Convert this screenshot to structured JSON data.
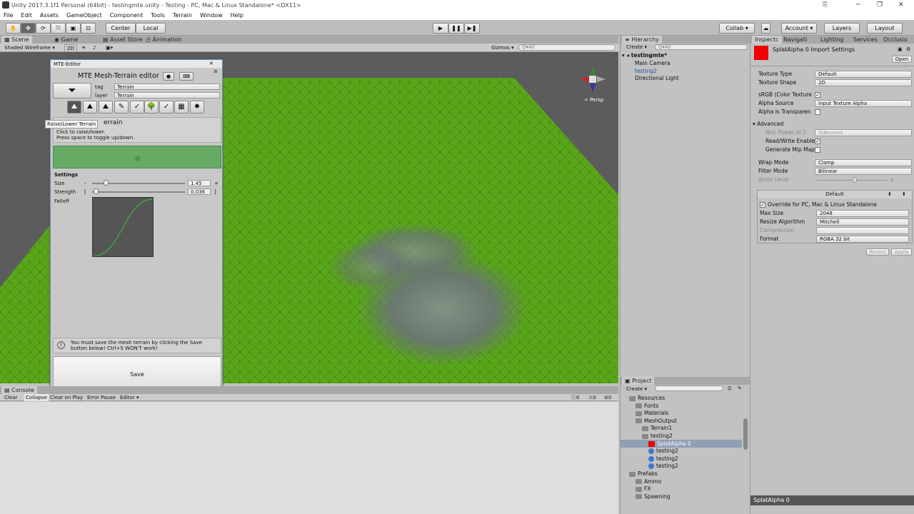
{
  "window": {
    "title": "Unity 2017.3.1f1 Personal (64bit) - testingmte.unity - Testing - PC, Mac & Linux Standalone* <DX11>"
  },
  "menu": [
    "File",
    "Edit",
    "Assets",
    "GameObject",
    "Component",
    "Tools",
    "Terrain",
    "Window",
    "Help"
  ],
  "toolbar": {
    "center": "Center",
    "local": "Local",
    "collab": "Collab ▾",
    "account": "Account ▾",
    "layers": "Layers",
    "layout": "Layout"
  },
  "tabs": {
    "scene": "Scene",
    "game": "Game",
    "asset_store": "Asset Store",
    "animation": "Animation",
    "hierarchy": "Hierarchy",
    "inspector": "Inspectc",
    "navigation": "Navigati",
    "lighting": "Lighting",
    "services": "Services",
    "occlusion": "Occlusio",
    "project": "Project",
    "console": "Console"
  },
  "scenebar": {
    "shading": "Shaded Wireframe",
    "mode2d": "2D",
    "gizmos": "Gizmos",
    "search": "Q▾All",
    "persp": "< Persp"
  },
  "mte": {
    "window_title": "MTE-Editor",
    "title": "MTE Mesh-Terrain editor",
    "tag_label": "tag",
    "tag_value": "Terrain",
    "layer_label": "layer",
    "layer_value": "Terrain",
    "tool_name": "errain",
    "tooltip": "Raise/Lower Terrain",
    "desc1": "Click to raise/lower.",
    "desc2": "Press space to toggle up/down.",
    "settings": "Settings",
    "size_label": "Size",
    "size_value": "1.45",
    "strength_label": "Strength",
    "strength_value": "0.036",
    "falloff_label": "Falloff",
    "warning": "You must save the mesh terrain by clicking the Save button below! Ctrl+S WON'T work!",
    "save": "Save"
  },
  "hierarchy": {
    "create": "Create ▾",
    "search": "Q▾All",
    "scene": "testingmte*",
    "items": [
      "Main Camera",
      "testing2",
      "Directional Light"
    ]
  },
  "project": {
    "create": "Create ▾",
    "items": [
      {
        "label": "Resources",
        "indent": 0
      },
      {
        "label": "Fonts",
        "indent": 1
      },
      {
        "label": "Materials",
        "indent": 1
      },
      {
        "label": "MeshOutput",
        "indent": 1
      },
      {
        "label": "Terrain1",
        "indent": 2
      },
      {
        "label": "testing2",
        "indent": 2
      },
      {
        "label": "SplatAlpha 0",
        "indent": 3,
        "selected": true
      },
      {
        "label": "testing2",
        "indent": 3
      },
      {
        "label": "testing2",
        "indent": 3
      },
      {
        "label": "testing2",
        "indent": 3
      },
      {
        "label": "Prefabs",
        "indent": 0
      },
      {
        "label": "Ammo",
        "indent": 1
      },
      {
        "label": "FX",
        "indent": 1
      },
      {
        "label": "Spawning",
        "indent": 1
      }
    ]
  },
  "inspector": {
    "title": "SplatAlpha 0 Import Settings",
    "open": "Open",
    "rows": [
      {
        "label": "Texture Type",
        "value": "Default"
      },
      {
        "label": "Texture Shape",
        "value": "2D"
      }
    ],
    "srgb": "sRGB (Color Texture",
    "alpha_source": "Alpha Source",
    "alpha_source_value": "Input Texture Alpha",
    "alpha_transparent": "Alpha Is Transparen",
    "advanced": "Advanced",
    "npot": "Non Power of 2",
    "npot_value": "ToNearest",
    "readwrite": "Read/Write Enable",
    "mipmap": "Generate Mip Map",
    "wrap": "Wrap Mode",
    "wrap_value": "Clamp",
    "filter": "Filter Mode",
    "filter_value": "Bilinear",
    "aniso": "Aniso Level",
    "aniso_value": "9",
    "platform": "Default",
    "override": "Override for PC, Mac & Linux Standalone",
    "maxsize": "Max Size",
    "maxsize_value": "2048",
    "resize": "Resize Algorithm",
    "resize_value": "Mitchell",
    "compression": "Compression",
    "format": "Format",
    "format_value": "RGBA 32 bit",
    "revert": "Revert",
    "apply": "Apply",
    "footer": "SplatAlpha 0"
  },
  "console": {
    "clear": "Clear",
    "collapse": "Collapse",
    "clear_on_play": "Clear on Play",
    "error_pause": "Error Pause",
    "editor": "Editor ▾",
    "c0": "0",
    "c1": "0",
    "c2": "0"
  }
}
